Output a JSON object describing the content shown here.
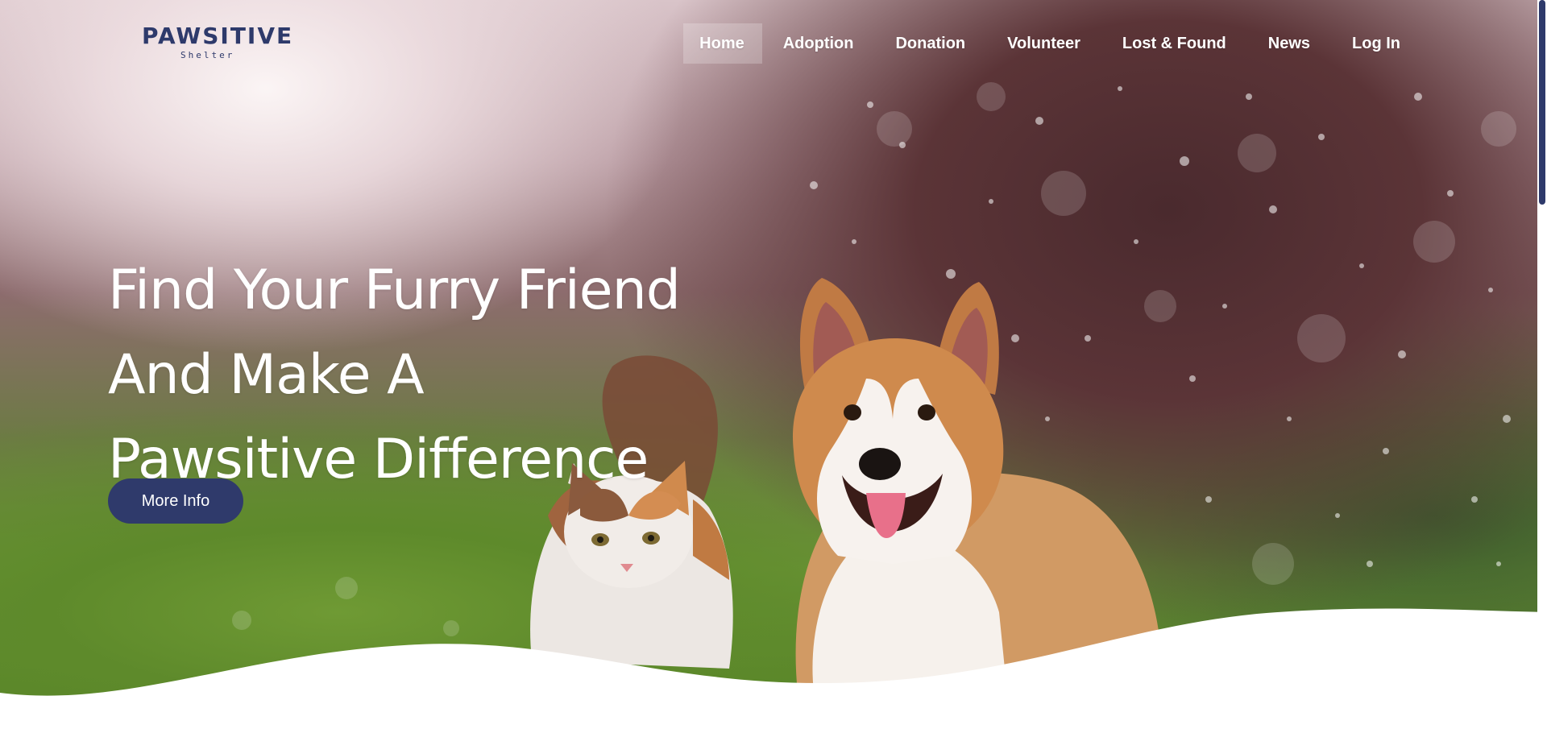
{
  "brand": {
    "name": "PAWSITIVE",
    "sub": "Shelter",
    "color": "#2e3a6b"
  },
  "nav": {
    "items": [
      {
        "label": "Home",
        "active": true
      },
      {
        "label": "Adoption"
      },
      {
        "label": "Donation"
      },
      {
        "label": "Volunteer"
      },
      {
        "label": "Lost & Found"
      },
      {
        "label": "News"
      },
      {
        "label": "Log In"
      }
    ]
  },
  "hero": {
    "line1": "Find Your Furry Friend",
    "line2": "And Make A",
    "line3": "Pawsitive Difference",
    "cta_label": "More Info",
    "background_image": "cat-and-corgi-in-grass",
    "cta_color": "#2f3a6b"
  },
  "icons": {
    "logo_paw": "paw-print-icon"
  }
}
